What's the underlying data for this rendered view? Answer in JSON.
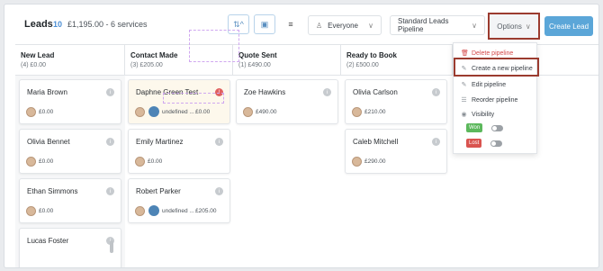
{
  "header": {
    "title": "Leads",
    "count": "10",
    "summary": "£1,195.00 - 6 services",
    "owner_filter": "Everyone",
    "pipeline_select": "Standard Leads Pipeline",
    "options_label": "Options",
    "create_label": "Create Lead",
    "view_icons": [
      "sort-icon",
      "calendar-icon",
      "list-icon"
    ]
  },
  "columns": [
    {
      "name": "New Lead",
      "summary": "(4) £0.00",
      "cards": [
        {
          "name": "Maria Brown",
          "amount": "£0.00"
        },
        {
          "name": "Olivia Bennet",
          "amount": "£0.00"
        },
        {
          "name": "Ethan Simmons",
          "amount": "£0.00"
        },
        {
          "name": "Lucas Foster",
          "amount": ""
        }
      ]
    },
    {
      "name": "Contact Made",
      "summary": "(3) £205.00",
      "cards": [
        {
          "name": "Daphne Green Test",
          "assignee": "undefined ...",
          "amount": "£0.00"
        },
        {
          "name": "Emily Martinez",
          "amount": "£0.00"
        },
        {
          "name": "Robert Parker",
          "assignee": "undefined ...",
          "amount": "£205.00"
        }
      ]
    },
    {
      "name": "Quote Sent",
      "summary": "(1) £490.00",
      "cards": [
        {
          "name": "Zoe Hawkins",
          "amount": "£490.00"
        }
      ]
    },
    {
      "name": "Ready to Book",
      "summary": "(2) £500.00",
      "cards": [
        {
          "name": "Olivia Carlson",
          "amount": "£210.00"
        },
        {
          "name": "Caleb Mitchell",
          "amount": "£290.00"
        }
      ]
    }
  ],
  "options_menu": {
    "items": [
      {
        "label": "Delete pipeline",
        "icon": "trash-icon"
      },
      {
        "label": "Create a new pipeline",
        "icon": "pencil-icon"
      },
      {
        "label": "Edit pipeline",
        "icon": "pencil-icon"
      },
      {
        "label": "Reorder pipeline",
        "icon": "reorder-icon"
      },
      {
        "label": "Visibility",
        "icon": "eye-icon"
      }
    ],
    "visibility": [
      {
        "label": "Won",
        "color": "#5cb85c"
      },
      {
        "label": "Lost",
        "color": "#d9534f"
      }
    ]
  },
  "colors": {
    "accent": "#5ba6d8",
    "highlight_box": "#9b3b2f",
    "danger": "#d44a4a"
  }
}
